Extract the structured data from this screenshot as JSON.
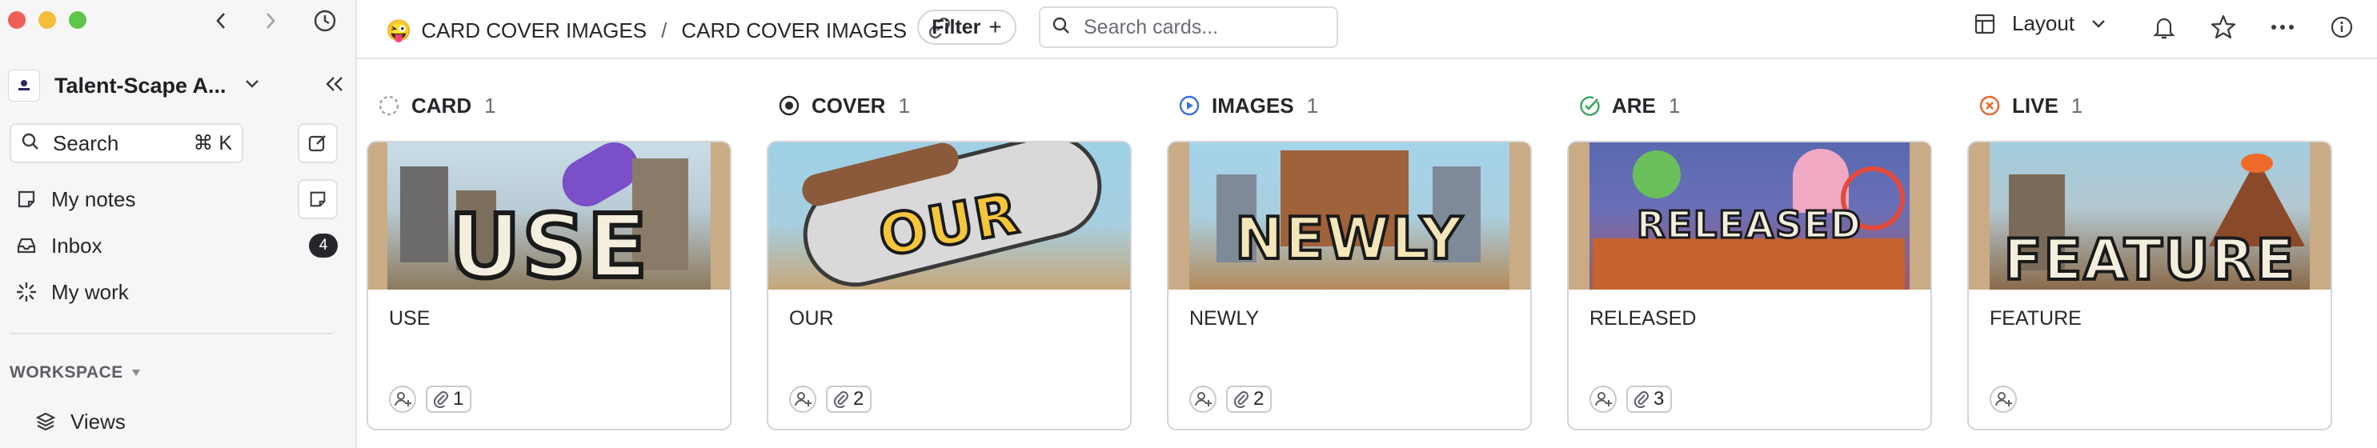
{
  "sidebar": {
    "workspace_name": "Talent-Scape A...",
    "search_label": "Search",
    "search_shortcut": "⌘ K",
    "items": [
      {
        "label": "My notes",
        "icon": "notes-icon"
      },
      {
        "label": "Inbox",
        "icon": "inbox-icon",
        "badge": "4"
      },
      {
        "label": "My work",
        "icon": "loading-icon"
      }
    ],
    "section_label": "WORKSPACE",
    "views_label": "Views"
  },
  "topbar": {
    "emoji": "😜",
    "crumb_1": "CARD COVER IMAGES",
    "separator": "/",
    "crumb_2": "CARD COVER IMAGES",
    "filter_label": "Filter",
    "search_placeholder": "Search cards...",
    "layout_label": "Layout"
  },
  "columns": [
    {
      "name": "CARD",
      "count": "1",
      "status_icon": "dashed-circle-icon",
      "color": "#a1a1aa",
      "card": {
        "title": "USE",
        "cover_word": "USE",
        "attachments": "1",
        "cover_bg": "#c8dbe6"
      }
    },
    {
      "name": "COVER",
      "count": "1",
      "status_icon": "target-circle-icon",
      "color": "#26272b",
      "card": {
        "title": "OUR",
        "cover_word": "OUR",
        "attachments": "2",
        "cover_bg": "#9fcbe0"
      }
    },
    {
      "name": "IMAGES",
      "count": "1",
      "status_icon": "play-circle-icon",
      "color": "#3b6fe0",
      "card": {
        "title": "NEWLY",
        "cover_word": "NEWLY",
        "attachments": "2",
        "cover_bg": "#9ccde8"
      }
    },
    {
      "name": "ARE",
      "count": "1",
      "status_icon": "check-circle-icon",
      "color": "#3ba55c",
      "card": {
        "title": "RELEASED",
        "cover_word": "RELEASED",
        "attachments": "3",
        "cover_bg": "#5a6bb0"
      }
    },
    {
      "name": "LIVE",
      "count": "1",
      "status_icon": "x-circle-icon",
      "color": "#e8672c",
      "card": {
        "title": "FEATURE",
        "cover_word": "FEATURE",
        "attachments": null,
        "cover_bg": "#9ec4d8"
      }
    }
  ]
}
